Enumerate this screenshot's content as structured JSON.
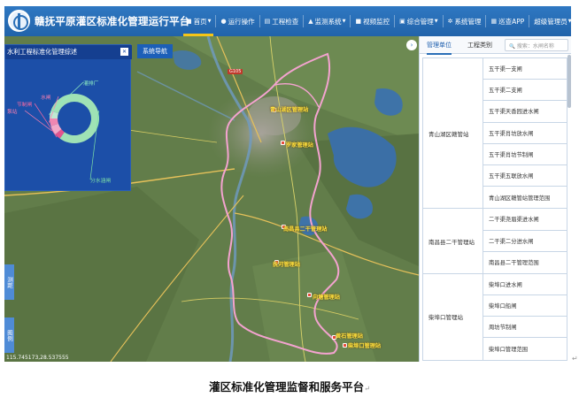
{
  "app": {
    "title": "赣抚平原灌区标准化管理运行平台"
  },
  "nav": [
    {
      "icon": "home-icon",
      "glyph": "■",
      "label": "首页",
      "caret": true,
      "active": true
    },
    {
      "icon": "drop-icon",
      "glyph": "●",
      "label": "运行操作",
      "caret": false
    },
    {
      "icon": "inspect-icon",
      "glyph": "▤",
      "label": "工程检查",
      "caret": false
    },
    {
      "icon": "monitor-icon",
      "glyph": "▲",
      "label": "监测系统",
      "caret": true
    },
    {
      "icon": "video-icon",
      "glyph": "■",
      "label": "视频监控",
      "caret": false
    },
    {
      "icon": "office-icon",
      "glyph": "▣",
      "label": "综合管理",
      "caret": true
    },
    {
      "icon": "gear-icon",
      "glyph": "✲",
      "label": "系统管理",
      "caret": false
    },
    {
      "icon": "app-icon",
      "glyph": "▦",
      "label": "巡查APP",
      "caret": false
    },
    {
      "icon": "user-icon",
      "glyph": "",
      "label": "超级管理员",
      "caret": true
    }
  ],
  "overview": {
    "title": "水利工程标准化管理综述",
    "chart_data": {
      "type": "pie",
      "categories": [
        "分水涵闸",
        "节制闸",
        "泵站",
        "水闸",
        "灌排厂"
      ],
      "values": [
        80,
        4,
        6,
        5,
        5
      ],
      "colors": [
        "#9fe2b5",
        "#e3548e",
        "#f3a8c8",
        "#ef87b2",
        "#bfe9d2"
      ],
      "legend_labels": [
        {
          "text": "分水涵闸",
          "color": "#7fe2a6"
        },
        {
          "text": "节制闸",
          "color": "#ff6aa2"
        },
        {
          "text": "泵站",
          "color": "#ff7fb0"
        },
        {
          "text": "水闸",
          "color": "#ff7fb0"
        },
        {
          "text": "灌排厂",
          "color": "#8ff0c2"
        }
      ]
    }
  },
  "map": {
    "system_nav": "系统导航",
    "side_tab_1": "测距",
    "side_tab_2": "图例",
    "coordinates": "115.745173,28.537555",
    "road_badge": "G105",
    "station_labels": [
      "青山湖区管理站",
      "罗家管理站",
      "南昌县二干管理站",
      "抚河管理站",
      "向塘管理站",
      "黄石管理站",
      "柴埠口管理站"
    ]
  },
  "right_panel": {
    "tab_management": "管理单位",
    "tab_engineering": "工程类别",
    "search_placeholder": "搜索：水闸名称",
    "groups": [
      {
        "name": "青山湖区赣管站",
        "items": [
          "五干渠一支闸",
          "五干渠二支闸",
          "五干渠天香园进水闸",
          "五干渠肖坊放水闸",
          "五干渠肖坊节制闸",
          "五干渠五联放水闸",
          "青山湖区赣管站管理范围"
        ]
      },
      {
        "name": "南昌县二干管理站",
        "items": [
          "二干渠尧眉渠进水闸",
          "二干渠二分进水闸",
          "南昌县二干管理范围"
        ]
      },
      {
        "name": "柴埠口管理站",
        "items": [
          "柴埠口进水闸",
          "柴埠口船闸",
          "周坊节制闸",
          "柴埠口管理范围"
        ]
      }
    ]
  },
  "caption": "灌区标准化管理监督和服务平台",
  "caption_mark": "↵",
  "edge_mark": "↵"
}
